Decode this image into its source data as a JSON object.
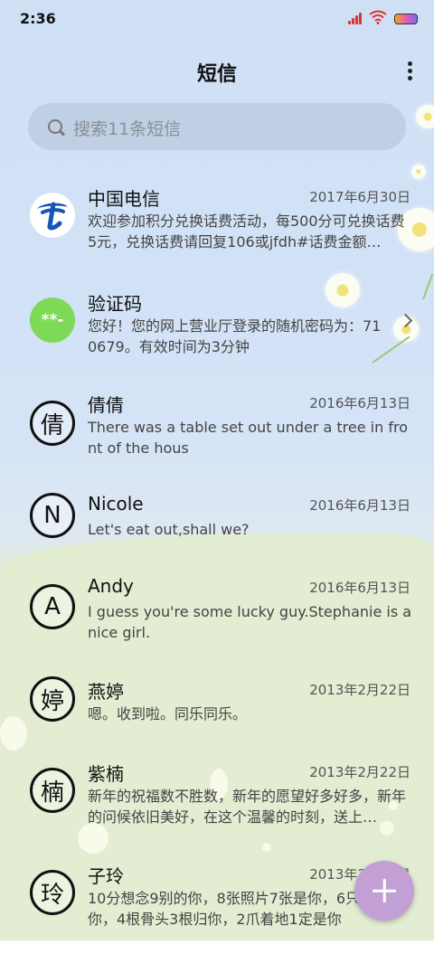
{
  "status": {
    "time": "2:36"
  },
  "header": {
    "title": "短信"
  },
  "search": {
    "placeholder": "搜索11条短信"
  },
  "conversations": [
    {
      "name": "中国电信",
      "date": "2017年6月30日",
      "preview": "欢迎参加积分兑换话费活动，每500分可兑换话费5元，兑换话费请回复106或jfdh#话费金额…",
      "avatar": "telecom-logo"
    },
    {
      "name": "验证码",
      "date": "",
      "preview": "您好！您的网上营业厅登录的随机密码为：710679。有效时间为3分钟",
      "avatar_text": "**-"
    },
    {
      "name": "倩倩",
      "date": "2016年6月13日",
      "preview": "There was a table set out under a tree in front of the hous",
      "avatar_text": "倩"
    },
    {
      "name": "Nicole",
      "date": "2016年6月13日",
      "preview": "Let's eat out,shall we?",
      "avatar_text": "N"
    },
    {
      "name": "Andy",
      "date": "2016年6月13日",
      "preview": "I guess you're some lucky guy.Stephanie is a nice girl.",
      "avatar_text": "A"
    },
    {
      "name": "燕婷",
      "date": "2013年2月22日",
      "preview": "嗯。收到啦。同乐同乐。",
      "avatar_text": "婷"
    },
    {
      "name": "紫楠",
      "date": "2013年2月22日",
      "preview": "新年的祝福数不胜数，新年的愿望好多好多，新年的问候依旧美好，在这个温馨的时刻，送上…",
      "avatar_text": "楠"
    },
    {
      "name": "子玲",
      "date": "2013年2月22日",
      "preview": "10分想念9别的你，8张照片7张是你，6只只像你，4根骨头3根归你，2爪着地1定是你",
      "avatar_text": "玲"
    }
  ],
  "colors": {
    "accent_fab": "#c2a0d6",
    "verify_green": "#7ed957",
    "telecom_blue": "#1456b8"
  },
  "icons": {
    "search": "search-icon",
    "more": "more-vertical-icon",
    "compose": "plus-icon",
    "chevron": "chevron-right-icon"
  }
}
